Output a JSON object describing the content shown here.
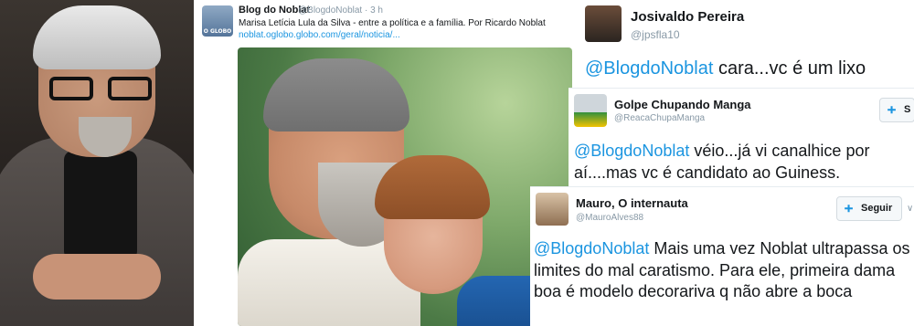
{
  "main_tweet": {
    "name": "Blog do Noblat",
    "handle": "@BlogdoNoblat",
    "time": "· 3 h",
    "text": "Marisa Letícia Lula da Silva - entre a política e a família. Por Ricardo Noblat",
    "link": "noblat.oglobo.globo.com/geral/noticia/...",
    "avatar_caption": "O GLOBO"
  },
  "replies": [
    {
      "name": "Josivaldo Pereira",
      "handle": "@jpsfla10",
      "mention": "@BlogdoNoblat",
      "text": " cara...vc é um lixo"
    },
    {
      "name": "Golpe Chupando Manga",
      "handle": "@ReacaChupaManga",
      "mention": "@BlogdoNoblat",
      "text": " véio...já vi canalhice por aí....mas vc é candidato ao Guiness.",
      "button": "S"
    },
    {
      "name": "Mauro, O internauta",
      "handle": "@MauroAlves88",
      "mention": "@BlogdoNoblat",
      "text": " Mais uma vez Noblat ultrapassa os limites do mal caratismo. Para ele,  primeira dama boa é modelo decorariva q não abre a boca",
      "button": "Seguir"
    }
  ],
  "icons": {
    "follow": "person-plus-icon",
    "more": "chevron-down-icon"
  },
  "colors": {
    "mention_blue": "#1b95e0",
    "handle_gray": "#8899a6"
  }
}
